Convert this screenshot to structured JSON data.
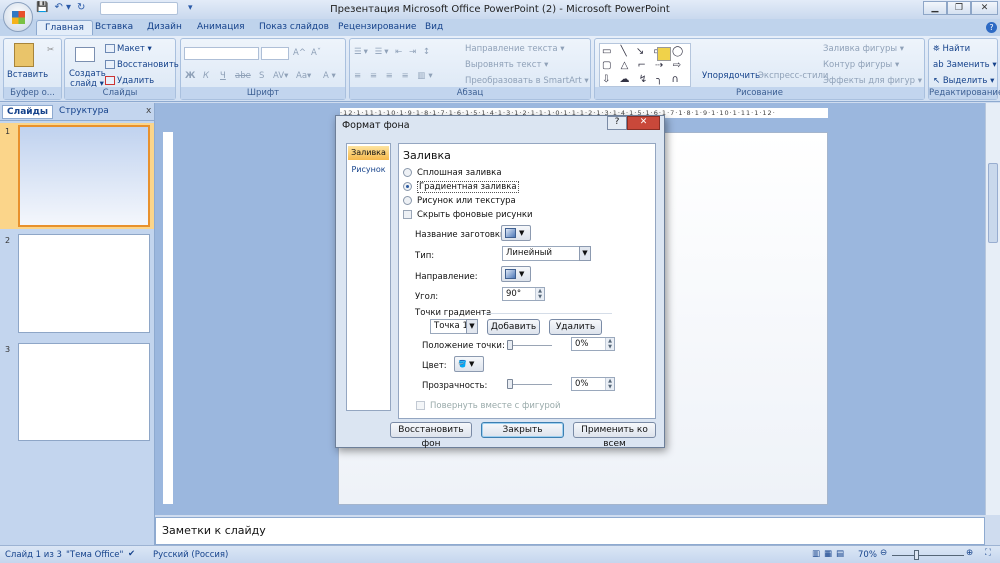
{
  "window": {
    "title": "Презентация Microsoft Office PowerPoint (2) - Microsoft PowerPoint",
    "minimize": "▁",
    "restore": "❐",
    "close": "✕"
  },
  "qat": {
    "save": "💾",
    "undo": "↶ ▾",
    "redo": "↻",
    "customize": "▾"
  },
  "tabs": [
    "Главная",
    "Вставка",
    "Дизайн",
    "Анимация",
    "Показ слайдов",
    "Рецензирование",
    "Вид"
  ],
  "ribbon": {
    "clipboard": {
      "label": "Буфер о...",
      "paste": "Вставить"
    },
    "slides": {
      "label": "Слайды",
      "new_slide": "Создать слайд ▾",
      "layout": "Макет ▾",
      "reset": "Восстановить",
      "delete": "Удалить"
    },
    "font": {
      "label": "Шрифт",
      "bold": "Ж",
      "italic": "К",
      "underline": "Ч",
      "strike": "abe",
      "shadow": "S",
      "spacing": "AV▾",
      "case": "Aa▾",
      "grow": "A^",
      "shrink": "Aˇ",
      "color": "A ▾"
    },
    "paragraph": {
      "label": "Абзац",
      "text_direction": "Направление текста ▾",
      "align_text": "Выровнять текст ▾",
      "smartart": "Преобразовать в SmartArt ▾"
    },
    "drawing": {
      "label": "Рисование",
      "arrange": "Упорядочить",
      "quick_styles": "Экспресс-стили",
      "shape_fill": "Заливка фигуры ▾",
      "shape_outline": "Контур фигуры ▾",
      "shape_effects": "Эффекты для фигур ▾",
      "shapes": "▭ ╲ ↘ ▭ ◯ ▢ △ ⌐ ⇢ ⇨ ⇩ ☁ ↯ ╮ ∩ { } ☆"
    },
    "editing": {
      "label": "Редактирование",
      "find": "Найти",
      "replace": "Заменить ▾",
      "select": "Выделить ▾"
    }
  },
  "left_pane": {
    "tabs": [
      "Слайды",
      "Структура"
    ],
    "close": "x",
    "slides": [
      "1",
      "2",
      "3"
    ],
    "selected_slide": 1
  },
  "ruler": {
    "h": "·12·1·11·1·10·1·9·1·8·1·7·1·6·1·5·1·4·1·3·1·2·1·1·1·0·1·1·1·2·1·3·1·4·1·5·1·6·1·7·1·8·1·9·1·10·1·11·1·12·"
  },
  "notes": {
    "placeholder": "Заметки к слайду"
  },
  "status": {
    "slide": "Слайд 1 из 3",
    "theme": "\"Тема Office\"",
    "language": "Русский (Россия)",
    "zoom": "70%",
    "zoom_value": 70
  },
  "dialog": {
    "title": "Формат фона",
    "help": "?",
    "close": "✕",
    "nav": [
      "Заливка",
      "Рисунок"
    ],
    "nav_selected": "Заливка",
    "heading": "Заливка",
    "options": [
      {
        "label": "Сплошная заливка",
        "selected": false
      },
      {
        "label": "Градиентная заливка",
        "selected": true
      },
      {
        "label": "Рисунок или текстура",
        "selected": false
      }
    ],
    "hide_bg": {
      "label": "Скрыть фоновые рисунки",
      "checked": false
    },
    "preset_label": "Название заготовки:",
    "type_label": "Тип:",
    "type_value": "Линейный",
    "direction_label": "Направление:",
    "angle_label": "Угол:",
    "angle_value": "90°",
    "stops_label": "Точки градиента",
    "stop_value": "Точка 1",
    "add": "Добавить",
    "remove": "Удалить",
    "position_label": "Положение точки:",
    "position_value": "0%",
    "color_label": "Цвет:",
    "transparency_label": "Прозрачность:",
    "transparency_value": "0%",
    "rotate": {
      "label": "Повернуть вместе с фигурой",
      "checked": false
    },
    "reset": "Восстановить фон",
    "close_btn": "Закрыть",
    "apply_all": "Применить ко всем"
  }
}
